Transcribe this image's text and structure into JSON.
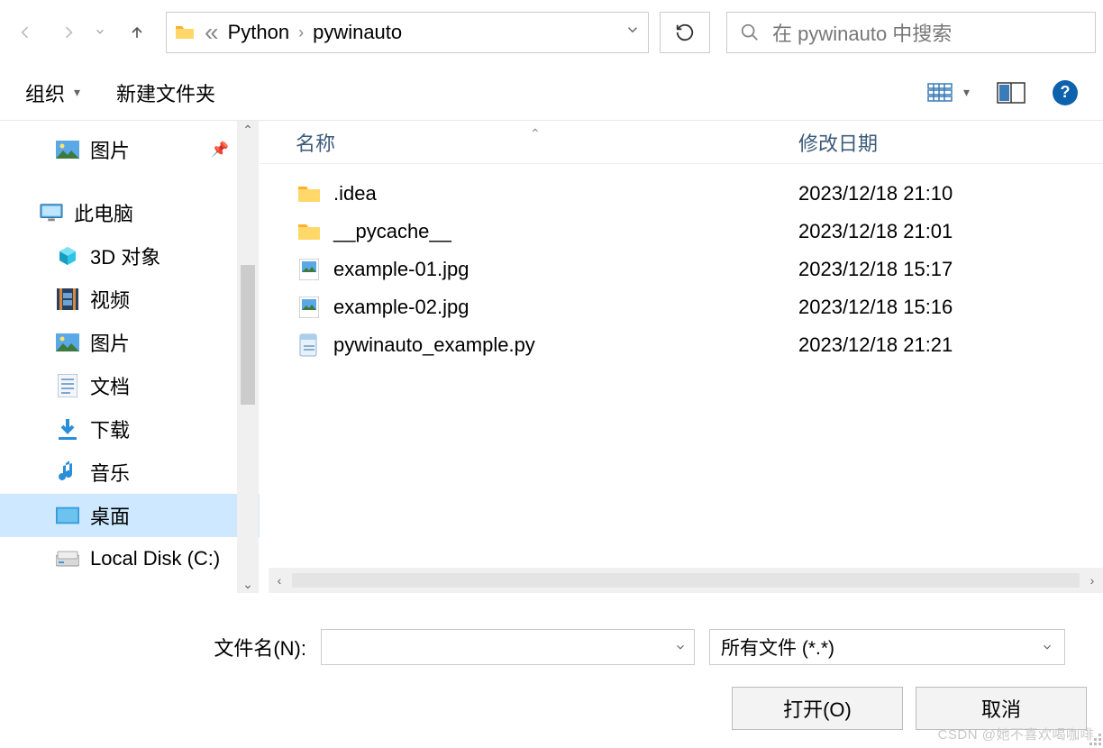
{
  "nav": {
    "breadcrumb": [
      "Python",
      "pywinauto"
    ]
  },
  "search": {
    "placeholder": "在 pywinauto 中搜索"
  },
  "toolbar": {
    "organize": "组织",
    "new_folder": "新建文件夹"
  },
  "sidebar": {
    "items": [
      {
        "label": "图片",
        "icon": "image",
        "pinned": true
      },
      {
        "label": "此电脑",
        "icon": "pc",
        "class": "pc"
      },
      {
        "label": "3D 对象",
        "icon": "3d"
      },
      {
        "label": "视频",
        "icon": "video"
      },
      {
        "label": "图片",
        "icon": "image"
      },
      {
        "label": "文档",
        "icon": "doc"
      },
      {
        "label": "下载",
        "icon": "download"
      },
      {
        "label": "音乐",
        "icon": "music"
      },
      {
        "label": "桌面",
        "icon": "desktop",
        "selected": true
      },
      {
        "label": "Local Disk (C:)",
        "icon": "disk"
      }
    ]
  },
  "headers": {
    "name": "名称",
    "date": "修改日期"
  },
  "files": [
    {
      "name": ".idea",
      "date": "2023/12/18 21:10",
      "type": "folder"
    },
    {
      "name": "__pycache__",
      "date": "2023/12/18 21:01",
      "type": "folder"
    },
    {
      "name": "example-01.jpg",
      "date": "2023/12/18 15:17",
      "type": "image"
    },
    {
      "name": "example-02.jpg",
      "date": "2023/12/18 15:16",
      "type": "image"
    },
    {
      "name": "pywinauto_example.py",
      "date": "2023/12/18 21:21",
      "type": "py"
    }
  ],
  "bottom": {
    "filename_label": "文件名(N):",
    "filter": "所有文件 (*.*)",
    "open": "打开(O)",
    "cancel": "取消"
  },
  "watermark": "CSDN @她不喜欢喝咖啡"
}
